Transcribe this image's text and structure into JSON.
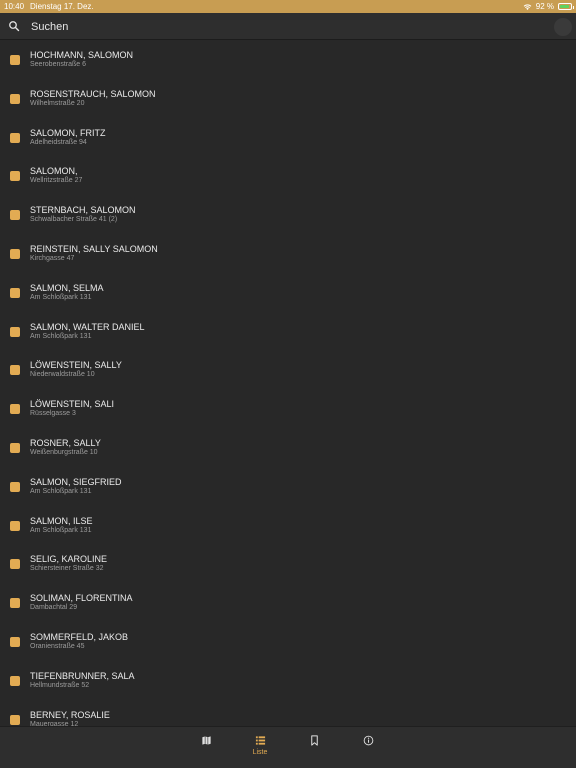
{
  "status_bar": {
    "time": "10:40",
    "date": "Dienstag 17. Dez.",
    "battery": "92 %"
  },
  "search": {
    "placeholder": "Suchen"
  },
  "colors": {
    "accent": "#e2ab53",
    "status_bar": "#c89d52",
    "background": "#282828"
  },
  "list": {
    "items": [
      {
        "name": "HOCHMANN, SALOMON",
        "address": "Seerobenstraße 6"
      },
      {
        "name": "ROSENSTRAUCH, SALOMON",
        "address": "Wilhelmstraße 20"
      },
      {
        "name": "SALOMON, FRITZ",
        "address": "Adelheidstraße 94"
      },
      {
        "name": "SALOMON,",
        "address": "Wellritzstraße 27"
      },
      {
        "name": "STERNBACH, SALOMON",
        "address": "Schwalbacher Straße 41 (2)"
      },
      {
        "name": "REINSTEIN, SALLY SALOMON",
        "address": "Kirchgasse 47"
      },
      {
        "name": "SALMON, SELMA",
        "address": "Am Schloßpark 131"
      },
      {
        "name": "SALMON, WALTER DANIEL",
        "address": "Am Schloßpark 131"
      },
      {
        "name": "LÖWENSTEIN, SALLY",
        "address": "Niederwaldstraße 10"
      },
      {
        "name": "LÖWENSTEIN, SALI",
        "address": "Rüsselgasse 3"
      },
      {
        "name": "ROSNER, SALLY",
        "address": "Weißenburgstraße 10"
      },
      {
        "name": "SALMON, SIEGFRIED",
        "address": "Am Schloßpark 131"
      },
      {
        "name": "SALMON, ILSE",
        "address": "Am Schloßpark 131"
      },
      {
        "name": "SELIG, KAROLINE",
        "address": "Schiersteiner Straße 32"
      },
      {
        "name": "SOLIMAN, FLORENTINA",
        "address": "Dambachtal 29"
      },
      {
        "name": "SOMMERFELD, JAKOB",
        "address": "Oranienstraße 45"
      },
      {
        "name": "TIEFENBRUNNER, SALA",
        "address": "Hellmundstraße 52"
      },
      {
        "name": "BERNEY, ROSALIE",
        "address": "Mauergasse 12"
      }
    ]
  },
  "tab_bar": {
    "tabs": [
      {
        "icon": "map-icon",
        "label": ""
      },
      {
        "icon": "list-icon",
        "label": "Liste",
        "active": true
      },
      {
        "icon": "bookmark-icon",
        "label": ""
      },
      {
        "icon": "info-icon",
        "label": ""
      }
    ]
  }
}
